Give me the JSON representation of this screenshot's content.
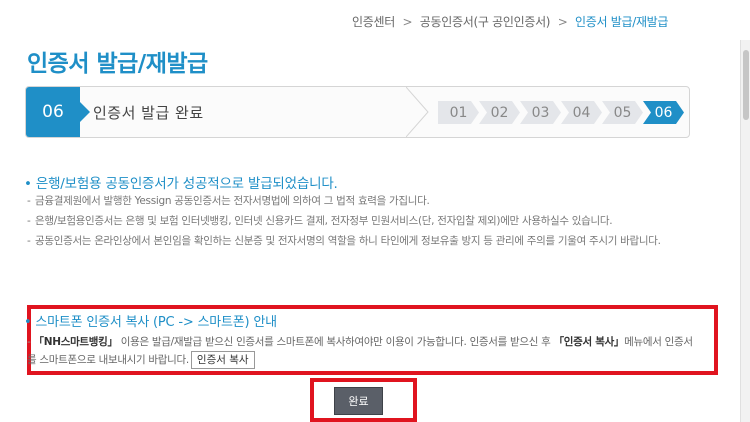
{
  "breadcrumb": {
    "items": [
      "인증센터",
      "공동인증서(구 공인인증서)",
      "인증서 발급/재발급"
    ],
    "separator": ">"
  },
  "page_title": "인증서 발급/재발급",
  "step": {
    "current_number": "06",
    "current_label": "인증서 발급 완료",
    "steps": [
      "01",
      "02",
      "03",
      "04",
      "05",
      "06"
    ],
    "active_index": 5
  },
  "success": {
    "heading": "• 은행/보험용 공동인증서가 성공적으로 발급되었습니다.",
    "notes": [
      "금융결제원에서 발행한 Yessign 공동인증서는 전자서명법에 의하여 그 법적 효력을 가집니다.",
      "은행/보험용인증서는 은행 및 보험 인터넷뱅킹, 인터넷 신용카드 결제, 전자정부 민원서비스(단, 전자입찰 제외)에만 사용하실수 있습니다.",
      "공동인증서는 온라인상에서 본인임을 확인하는 신분증 및 전자서명의 역할을 하니 타인에게 정보유출 방지 등 관리에 주의를 기울여 주시기 바랍니다."
    ]
  },
  "smartphone_copy": {
    "heading": "• 스마트폰 인증서 복사 (PC -> 스마트폰) 안내",
    "app_name": "「NH스마트뱅킹」",
    "body_part1": " 이용은 발급/재발급 받으신 인증서를 스마트폰에 복사하여야만 이용이 가능합니다. 인증서를 받으신 후 ",
    "menu_name": "「인증서 복사」",
    "body_part2": "메뉴에서 인증서를 스마트폰으로 내보내시기 바랍니다.",
    "copy_button_label": "인증서 복사"
  },
  "done_button_label": "완료",
  "colors": {
    "accent": "#1f8fc7",
    "highlight_border": "#e0141f",
    "done_button": "#5a5f68"
  }
}
